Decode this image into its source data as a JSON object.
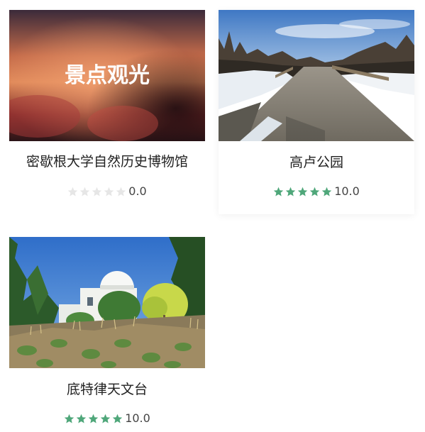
{
  "colors": {
    "star_filled": "#4fa77a",
    "star_empty": "#e6e6e6"
  },
  "cards": [
    {
      "overlay_text": "景点观光",
      "title": "密歇根大学自然历史博物馆",
      "stars": 0,
      "score": "0.0"
    },
    {
      "title": "高卢公园",
      "stars": 5,
      "score": "10.0"
    },
    {
      "title": "底特律天文台",
      "stars": 5,
      "score": "10.0"
    }
  ]
}
